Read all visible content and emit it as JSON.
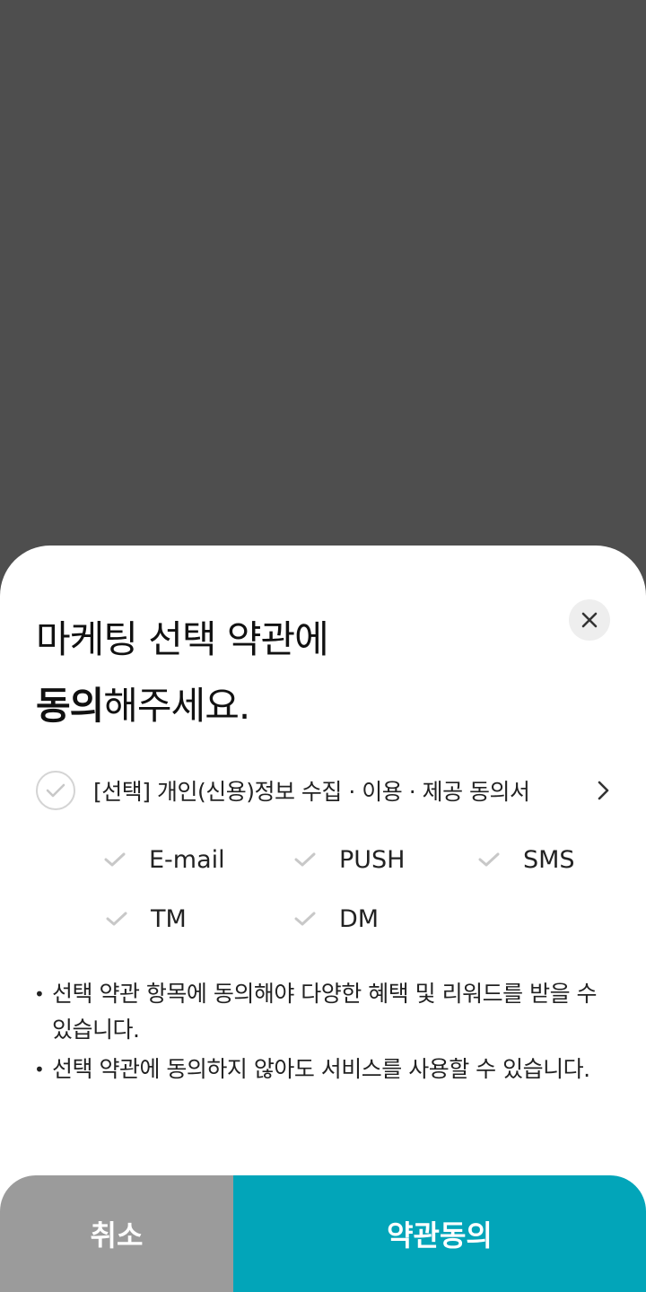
{
  "sheet": {
    "title_line1": "마케팅 선택 약관에",
    "title_line2_bold": "동의",
    "title_line2_rest": "해주세요."
  },
  "agreement": {
    "label": "[선택] 개인(신용)정보 수집 · 이용 · 제공 동의서",
    "checked": false
  },
  "channels": [
    {
      "label": "E-mail",
      "checked": false
    },
    {
      "label": "PUSH",
      "checked": false
    },
    {
      "label": "SMS",
      "checked": false
    },
    {
      "label": "TM",
      "checked": false
    },
    {
      "label": "DM",
      "checked": false
    }
  ],
  "notes": [
    "선택 약관 항목에 동의해야 다양한 혜택 및 리워드를 받을 수 있습니다.",
    "선택 약관에 동의하지 않아도 서비스를 사용할 수 있습니다."
  ],
  "buttons": {
    "cancel": "취소",
    "agree": "약관동의"
  },
  "colors": {
    "backdrop": "#4e4e4e",
    "primary": "#02a5b9",
    "cancel": "#9b9b9b",
    "check_inactive": "#c8c8c8"
  },
  "icons": {
    "close": "close-icon",
    "agree_check": "check-circle-icon",
    "chevron": "chevron-right-icon",
    "channel_check": "check-icon"
  }
}
